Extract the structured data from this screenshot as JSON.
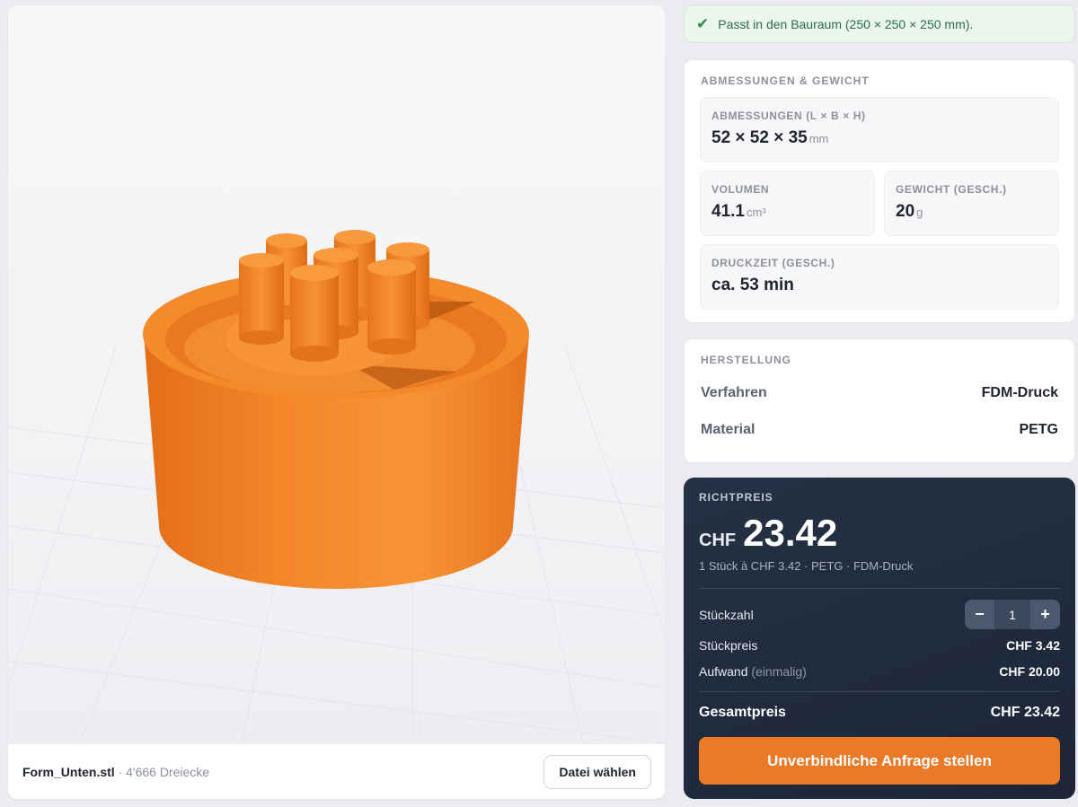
{
  "viewer": {
    "file_name": "Form_Unten.stl",
    "separator": " · ",
    "triangles": "4'666 Dreiecke",
    "choose_file_label": "Datei wählen",
    "model_color": "#f08a2c"
  },
  "fit": {
    "icon": "check-icon",
    "message": "Passt in den Bauraum (250 × 250 × 250 mm)."
  },
  "dimensions": {
    "section_title": "ABMESSUNGEN & GEWICHT",
    "size": {
      "label": "ABMESSUNGEN (L × B × H)",
      "value": "52 × 52 × 35",
      "unit": "mm"
    },
    "volume": {
      "label": "VOLUMEN",
      "value": "41.1",
      "unit": "cm³"
    },
    "weight": {
      "label": "GEWICHT (GESCH.)",
      "value": "20",
      "unit": "g"
    },
    "print_time": {
      "label": "DRUCKZEIT (GESCH.)",
      "value": "ca. 53 min"
    }
  },
  "manufacturing": {
    "section_title": "HERSTELLUNG",
    "process": {
      "label": "Verfahren",
      "value": "FDM-Druck"
    },
    "material": {
      "label": "Material",
      "value": "PETG"
    }
  },
  "pricing": {
    "section_title": "RICHTPREIS",
    "currency": "CHF",
    "amount": "23.42",
    "summary": "1 Stück à CHF 3.42 · PETG · FDM-Druck",
    "quantity_label": "Stückzahl",
    "quantity": "1",
    "minus": "−",
    "plus": "+",
    "unit_price_label": "Stückpreis",
    "unit_price": "CHF 3.42",
    "setup_label": "Aufwand",
    "setup_note": "(einmalig)",
    "setup_price": "CHF 20.00",
    "total_label": "Gesamtpreis",
    "total": "CHF 23.42",
    "cta_label": "Unverbindliche Anfrage stellen",
    "accent_color": "#ea7a28"
  }
}
